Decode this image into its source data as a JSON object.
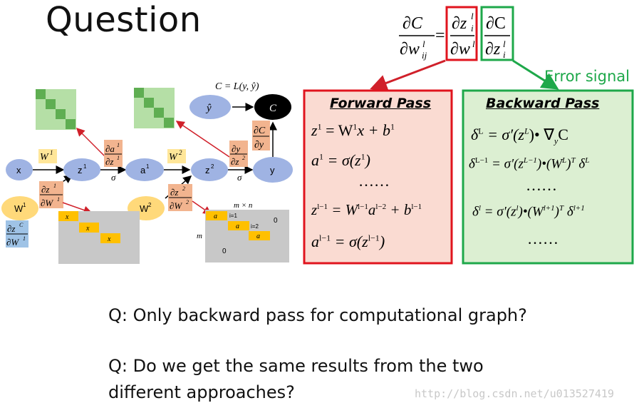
{
  "title": "Question",
  "header_formula": {
    "lhs_num": "∂C",
    "lhs_den": "∂w",
    "lhs_den_sup": "l",
    "lhs_den_sub": "ij",
    "equals": "=",
    "fwd_num": "∂z",
    "fwd_num_sup": "l",
    "fwd_num_sub": "i",
    "fwd_den": "∂w",
    "fwd_den_sup": "l",
    "fwd_den_sub": "ij",
    "bwd_num": "∂C",
    "bwd_den": "∂z",
    "bwd_den_sup": "l",
    "bwd_den_sub": "i"
  },
  "error_signal_label": "Error signal",
  "colors": {
    "red": "#e0141e",
    "green": "#1ea84a",
    "node_blue": "#9fb3e3",
    "node_yellow": "#ffd97a",
    "deriv_orange": "#f2b48f",
    "weight_yellow": "#ffe699",
    "fwd_fill": "#fadbd2",
    "bwd_fill": "#dcefd2",
    "matrix_gray": "#c8c8c8",
    "cell_orange": "#ffc000",
    "green_block": "#7bc86c"
  },
  "forward_box": {
    "title": "Forward Pass",
    "eq1_lhs": "z",
    "eq1_lhs_sup": "1",
    "eq1_rhs": "= W",
    "eq1_rhs_sup": "1",
    "eq1_rest": "x + b",
    "eq1_rest_sup": "1",
    "eq2": "a",
    "eq2_sup": "1",
    "eq2_rhs": "= σ(z",
    "eq2_rhs_sup": "1",
    "eq2_close": ")",
    "dots": "……",
    "eq3_lhs": "z",
    "eq3_lhs_sup": "l−1",
    "eq3_rhs": "= W",
    "eq3_rhs_sup": "l−1",
    "eq3_mid": "a",
    "eq3_mid_sup": "l−2",
    "eq3_end": "+ b",
    "eq3_end_sup": "l−1",
    "eq4": "a",
    "eq4_sup": "l−1",
    "eq4_rhs": "= σ(z",
    "eq4_rhs_sup": "l−1",
    "eq4_close": ")"
  },
  "backward_box": {
    "title": "Backward Pass",
    "eq1": "δ",
    "eq1_sup": "L",
    "eq1_rhs": "= σ′(z",
    "eq1_rhs_sup": "L",
    "eq1_rest": ")• ∇",
    "eq1_rest_sub": "y",
    "eq1_end": "C",
    "eq2": "δ",
    "eq2_sup": "L−1",
    "eq2_rhs": "= σ′(z",
    "eq2_rhs_sup": "L−1",
    "eq2_rest": ")•(W",
    "eq2_rest_sup": "L",
    "eq2_close": ")",
    "eq2_T": "T",
    "eq2_end": "δ",
    "eq2_end_sup": "L",
    "dots1": "……",
    "eq3": "δ",
    "eq3_sup": "l",
    "eq3_rhs": "= σ′(z",
    "eq3_rhs_sup": "l",
    "eq3_rest": ")•(W",
    "eq3_rest_sup": "l+1",
    "eq3_close": ")",
    "eq3_T": "T",
    "eq3_end": "δ",
    "eq3_end_sup": "l+1",
    "dots2": "……"
  },
  "graph": {
    "cost_label": "C = L(y, ŷ)",
    "nodes": {
      "x": "x",
      "z1": "z",
      "z1_sup": "1",
      "a1": "a",
      "a1_sup": "1",
      "z2": "z",
      "z2_sup": "2",
      "y": "y",
      "yhat": "ŷ",
      "C": "C",
      "W1": "W",
      "W1_sup": "1",
      "W2": "W",
      "W2_sup": "2"
    },
    "weights": {
      "w1": "W",
      "w1_sup": "1",
      "w2": "W",
      "w2_sup": "2"
    },
    "derivs": {
      "da1dz1_num": "∂a",
      "da1dz1_num_sup": "1",
      "da1dz1_den": "∂z",
      "da1dz1_den_sup": "1",
      "dydz2_num": "∂y",
      "dydz2_den": "∂z",
      "dydz2_den_sup": "2",
      "dCdy_num": "∂C",
      "dCdy_den": "∂y",
      "dz1dW1_num": "∂z",
      "dz1dW1_num_sup": "1",
      "dz1dW1_den": "∂W",
      "dz1dW1_den_sup": "1",
      "dz2dW2_num": "∂z",
      "dz2dW2_num_sup": "2",
      "dz2dW2_den": "∂W",
      "dz2dW2_den_sup": "2",
      "dzcdW1_num": "∂z",
      "dzcdW1_num_sup": "C",
      "dzcdW1_den": "∂W",
      "dzcdW1_den_sup": "1"
    },
    "sigma1": "σ",
    "sigma2": "σ",
    "matrix1": {
      "cell": "x"
    },
    "matrix2": {
      "dims": "m × n",
      "m": "m",
      "i1": "i=1",
      "i2": "i=2",
      "zero_a": "0",
      "zero_b": "0",
      "cell": "a"
    }
  },
  "questions": {
    "q1": "Q: Only backward pass for computational graph?",
    "q2_line1": "Q: Do we get the same results from the  two",
    "q2_line2": "different approaches?"
  },
  "watermark": "http://blog.csdn.net/u013527419"
}
